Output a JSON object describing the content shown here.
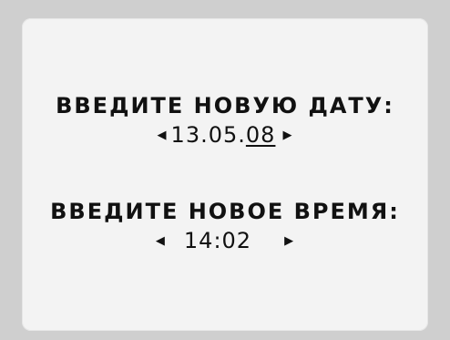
{
  "date_prompt": {
    "label": "ВВЕДИТЕ НОВУЮ ДАТУ:",
    "value_prefix": "13.05.",
    "value_cursor": "08",
    "left_arrow_icon": "triangle-left-icon",
    "right_arrow_icon": "triangle-right-icon"
  },
  "time_prompt": {
    "label": "ВВЕДИТЕ НОВОЕ ВРЕМЯ:",
    "value": "14:02",
    "left_arrow_icon": "triangle-left-icon",
    "right_arrow_icon": "triangle-right-icon"
  },
  "colors": {
    "bezel": "#cfcfcf",
    "screen": "#f3f3f3",
    "text": "#111111"
  }
}
